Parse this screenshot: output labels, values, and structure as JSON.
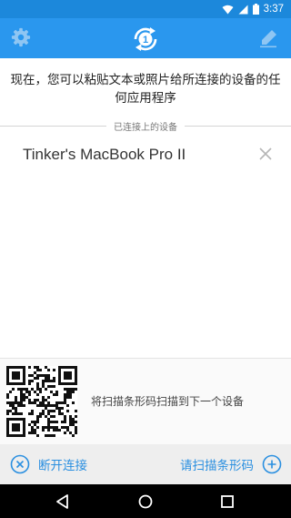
{
  "status_bar": {
    "time": "3:37",
    "icons": [
      "wifi-icon",
      "signal-icon",
      "battery-icon"
    ]
  },
  "app_bar": {
    "left_icon": "gear-icon",
    "center_icon": "sync-badge-icon",
    "center_badge": "1",
    "right_icon": "pen-icon",
    "background": "#2a97ee"
  },
  "intro_text": "现在，您可以粘贴文本或照片给所连接的设备的任何应用程序",
  "connected_section": {
    "header": "已连接上的设备",
    "devices": [
      {
        "name": "Tinker's MacBook Pro II"
      }
    ]
  },
  "qr_panel": {
    "instruction": "将扫描条形码扫描到下一个设备"
  },
  "actions": {
    "disconnect_label": "断开连接",
    "scan_label": "请扫描条形码",
    "accent": "#2a8fe0"
  },
  "nav_bar": {
    "icons": [
      "back-icon",
      "home-icon",
      "recents-icon"
    ]
  }
}
